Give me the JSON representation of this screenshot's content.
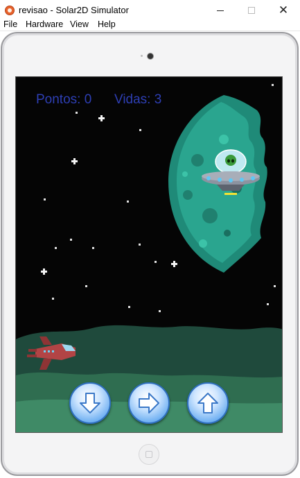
{
  "window": {
    "title": "revisao - Solar2D Simulator",
    "minimize_glyph": "",
    "close_glyph": "✕"
  },
  "menu": [
    "File",
    "Hardware",
    "View",
    "Help"
  ],
  "game": {
    "hud_points": "Pontos: 0",
    "hud_lives": "Vidas: 3",
    "colors": {
      "hud": "#2e3fb5",
      "planet": "#2aa58f",
      "hills": "#2f6d50",
      "ship": "#b24445",
      "button": "#6fb0f2"
    }
  },
  "controls": {
    "icons": [
      "arrow-down-icon",
      "arrow-right-icon",
      "arrow-up-icon"
    ]
  }
}
